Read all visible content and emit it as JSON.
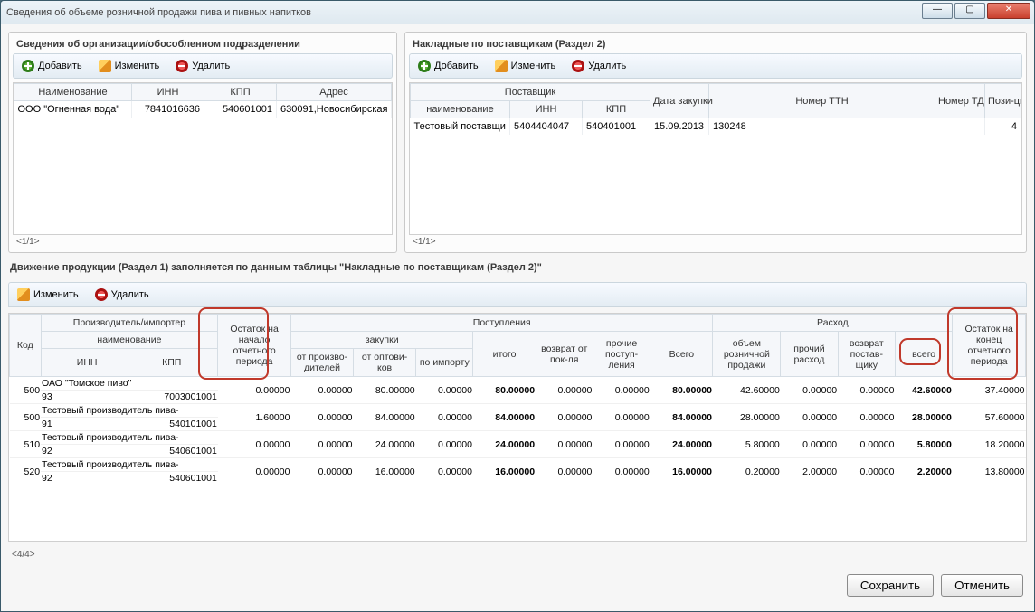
{
  "window": {
    "title": "Сведения об объеме розничной продажи пива и пивных напитков"
  },
  "buttons": {
    "add": "Добавить",
    "edit": "Изменить",
    "delete": "Удалить",
    "save": "Сохранить",
    "cancel": "Отменить"
  },
  "org_panel": {
    "title": "Сведения об организации/обособленном подразделении",
    "cols": {
      "name": "Наименование",
      "inn": "ИНН",
      "kpp": "КПП",
      "addr": "Адрес"
    },
    "rows": [
      {
        "name": "ООО \"Огненная вода\"",
        "inn": "7841016636",
        "kpp": "540601001",
        "addr": "630091,Новосибирская"
      }
    ],
    "pager": "<1/1>"
  },
  "supplier_panel": {
    "title": "Накладные по поставщикам (Раздел 2)",
    "cols": {
      "supplier": "Поставщик",
      "name": "наименование",
      "inn": "ИНН",
      "kpp": "КПП",
      "date": "Дата закупки",
      "ttn": "Номер ТТН",
      "td": "Номер ТД",
      "pos": "Пози-ций"
    },
    "rows": [
      {
        "name": "Тестовый поставщи",
        "inn": "5404404047",
        "kpp": "540401001",
        "date": "15.09.2013",
        "ttn": "130248",
        "td": "",
        "pos": "4"
      }
    ],
    "pager": "<1/1>"
  },
  "movement": {
    "title": "Движение продукции (Раздел 1) заполняется по данным таблицы \"Накладные по поставщикам (Раздел 2)\"",
    "pager": "<4/4>",
    "head": {
      "code": "Код",
      "producer": "Производитель/импортер",
      "name": "наименование",
      "inn": "ИНН",
      "kpp": "КПП",
      "rest_start": "Остаток на начало отчетного периода",
      "incoming": "Поступления",
      "purchases": "закупки",
      "from_prod": "от произво-дителей",
      "from_opt": "от оптови-ков",
      "by_import": "по импорту",
      "itogo": "итого",
      "return_buy": "возврат от пок-ля",
      "other_in": "прочие поступ-ления",
      "vsego_in": "Всего",
      "expense": "Расход",
      "retail": "объем розничной продажи",
      "other_exp": "прочий расход",
      "return_sup": "возврат постав-щику",
      "vsego": "всего",
      "rest_end": "Остаток на конец отчетного периода"
    }
  },
  "chart_data": {
    "type": "table",
    "columns": [
      "Код",
      "Наименование",
      "ИНН",
      "КПП",
      "Остаток на начало",
      "от производителей",
      "от оптовиков",
      "по импорту",
      "итого",
      "возврат от пок-ля",
      "прочие поступления",
      "Всего (поступления)",
      "объем розничной продажи",
      "прочий расход",
      "возврат поставщику",
      "всего (расход)",
      "Остаток на конец"
    ],
    "rows": [
      {
        "code": "500",
        "name": "ОАО \"Томское пиво\"",
        "sub": "93",
        "inn": "7003001001",
        "kpp": "",
        "rest_start": "0.00000",
        "from_prod": "0.00000",
        "from_opt": "80.00000",
        "by_import": "0.00000",
        "itogo": "80.00000",
        "ret_buy": "0.00000",
        "other_in": "0.00000",
        "vsego_in": "80.00000",
        "retail": "42.60000",
        "other_exp": "0.00000",
        "ret_sup": "0.00000",
        "vsego_exp": "42.60000",
        "rest_end": "37.40000"
      },
      {
        "code": "500",
        "name": "Тестовый производитель пива-",
        "sub": "91",
        "inn": "540101001",
        "kpp": "",
        "rest_start": "1.60000",
        "from_prod": "0.00000",
        "from_opt": "84.00000",
        "by_import": "0.00000",
        "itogo": "84.00000",
        "ret_buy": "0.00000",
        "other_in": "0.00000",
        "vsego_in": "84.00000",
        "retail": "28.00000",
        "other_exp": "0.00000",
        "ret_sup": "0.00000",
        "vsego_exp": "28.00000",
        "rest_end": "57.60000"
      },
      {
        "code": "510",
        "name": "Тестовый производитель пива-",
        "sub": "92",
        "inn": "540601001",
        "kpp": "",
        "rest_start": "0.00000",
        "from_prod": "0.00000",
        "from_opt": "24.00000",
        "by_import": "0.00000",
        "itogo": "24.00000",
        "ret_buy": "0.00000",
        "other_in": "0.00000",
        "vsego_in": "24.00000",
        "retail": "5.80000",
        "other_exp": "0.00000",
        "ret_sup": "0.00000",
        "vsego_exp": "5.80000",
        "rest_end": "18.20000"
      },
      {
        "code": "520",
        "name": "Тестовый производитель пива-",
        "sub": "92",
        "inn": "540601001",
        "kpp": "",
        "rest_start": "0.00000",
        "from_prod": "0.00000",
        "from_opt": "16.00000",
        "by_import": "0.00000",
        "itogo": "16.00000",
        "ret_buy": "0.00000",
        "other_in": "0.00000",
        "vsego_in": "16.00000",
        "retail": "0.20000",
        "other_exp": "2.00000",
        "ret_sup": "0.00000",
        "vsego_exp": "2.20000",
        "rest_end": "13.80000"
      }
    ]
  }
}
